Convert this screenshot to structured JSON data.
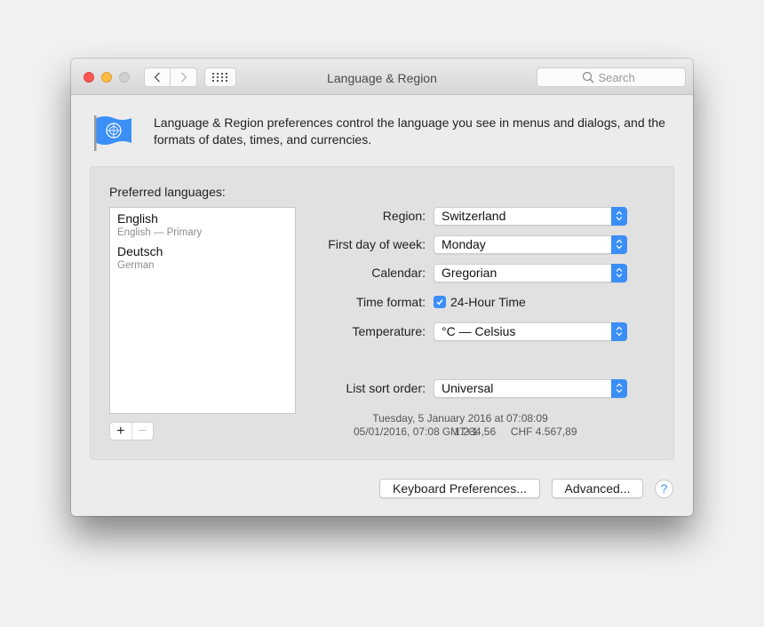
{
  "window": {
    "title": "Language & Region",
    "search_placeholder": "Search",
    "nav": {
      "back": "‹",
      "forward": "›"
    }
  },
  "intro": {
    "text": "Language & Region preferences control the language you see in menus and dialogs, and the formats of dates, times, and currencies."
  },
  "preferred_languages": {
    "label": "Preferred languages:",
    "items": [
      {
        "name": "English",
        "subtitle": "English — Primary"
      },
      {
        "name": "Deutsch",
        "subtitle": "German"
      }
    ],
    "add_label": "+",
    "remove_label": "−"
  },
  "settings": {
    "region": {
      "label": "Region:",
      "value": "Switzerland"
    },
    "first_day": {
      "label": "First day of week:",
      "value": "Monday"
    },
    "calendar": {
      "label": "Calendar:",
      "value": "Gregorian"
    },
    "time_format": {
      "label": "Time format:",
      "checkbox_label": "24-Hour Time",
      "checked": true
    },
    "temperature": {
      "label": "Temperature:",
      "value": "°C — Celsius"
    },
    "list_sort": {
      "label": "List sort order:",
      "value": "Universal"
    }
  },
  "sample": {
    "line1": "Tuesday, 5 January 2016 at 07:08:09 GMT+1",
    "line2": "05/01/2016, 07:08     1.234,56     CHF 4.567,89"
  },
  "buttons": {
    "keyboard": "Keyboard Preferences...",
    "advanced": "Advanced...",
    "help": "?"
  },
  "colors": {
    "accent": "#3a8ef6",
    "close": "#fc5753",
    "minimize": "#fdbc40",
    "zoom_disabled": "#d0d0d0"
  }
}
